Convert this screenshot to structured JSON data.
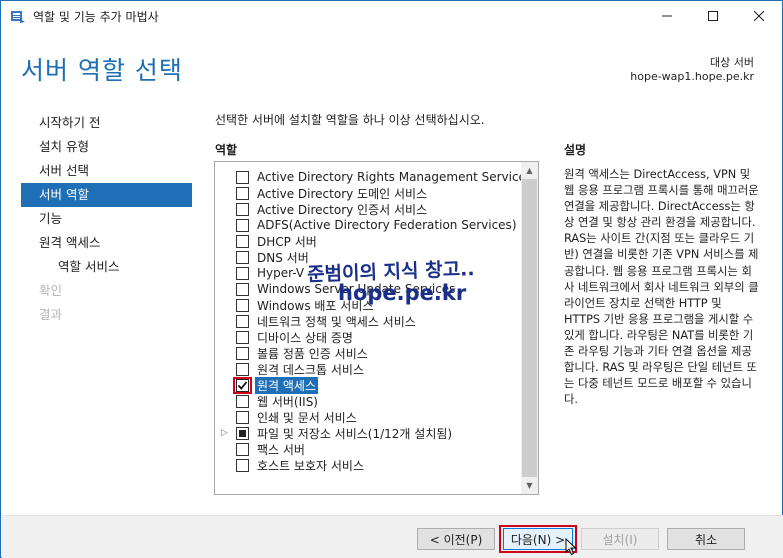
{
  "window": {
    "title": "역할 및 기능 추가 마법사"
  },
  "header": {
    "page_title": "서버 역할 선택",
    "dest_label": "대상 서버",
    "dest_server": "hope-wap1.hope.pe.kr"
  },
  "nav": {
    "items": [
      {
        "label": "시작하기 전",
        "state": "normal"
      },
      {
        "label": "설치 유형",
        "state": "normal"
      },
      {
        "label": "서버 선택",
        "state": "normal"
      },
      {
        "label": "서버 역할",
        "state": "selected"
      },
      {
        "label": "기능",
        "state": "normal"
      },
      {
        "label": "원격 액세스",
        "state": "normal"
      },
      {
        "label": "역할 서비스",
        "state": "sub"
      },
      {
        "label": "확인",
        "state": "disabled"
      },
      {
        "label": "결과",
        "state": "disabled"
      }
    ]
  },
  "main": {
    "instruction": "선택한 서버에 설치할 역할을 하나 이상 선택하십시오.",
    "roles_label": "역할",
    "roles": [
      {
        "label": "Active Directory Rights Management Services",
        "state": "unchecked"
      },
      {
        "label": "Active Directory 도메인 서비스",
        "state": "unchecked"
      },
      {
        "label": "Active Directory 인증서 서비스",
        "state": "unchecked"
      },
      {
        "label": "ADFS(Active Directory Federation Services)",
        "state": "unchecked"
      },
      {
        "label": "DHCP 서버",
        "state": "unchecked"
      },
      {
        "label": "DNS 서버",
        "state": "unchecked"
      },
      {
        "label": "Hyper-V",
        "state": "unchecked"
      },
      {
        "label": "Windows Server Update Services",
        "state": "unchecked"
      },
      {
        "label": "Windows 배포 서비스",
        "state": "unchecked"
      },
      {
        "label": "네트워크 정책 및 액세스 서비스",
        "state": "unchecked"
      },
      {
        "label": "디바이스 상태 증명",
        "state": "unchecked"
      },
      {
        "label": "볼륨 정품 인증 서비스",
        "state": "unchecked"
      },
      {
        "label": "원격 데스크톱 서비스",
        "state": "unchecked"
      },
      {
        "label": "원격 액세스",
        "state": "checked",
        "selected": true
      },
      {
        "label": "웹 서버(IIS)",
        "state": "unchecked"
      },
      {
        "label": "인쇄 및 문서 서비스",
        "state": "unchecked"
      },
      {
        "label": "파일 및 저장소 서비스(1/12개 설치됨)",
        "state": "partial",
        "expandable": true
      },
      {
        "label": "팩스 서버",
        "state": "unchecked"
      },
      {
        "label": "호스트 보호자 서비스",
        "state": "unchecked"
      }
    ]
  },
  "description": {
    "label": "설명",
    "text": "원격 액세스는 DirectAccess, VPN 및 웹 응용 프로그램 프록시를 통해 매끄러운 연결을 제공합니다. DirectAccess는 항상 연결 및 항상 관리 환경을 제공합니다. RAS는 사이트 간(지점 또는 클라우드 기반) 연결을 비롯한 기존 VPN 서비스를 제공합니다. 웹 응용 프로그램 프록시는 회사 네트워크에서 회사 네트워크 외부의 클라이언트 장치로 선택한 HTTP 및 HTTPS 기반 응용 프로그램을 게시할 수 있게 합니다. 라우팅은 NAT를 비롯한 기존 라우팅 기능과 기타 연결 옵션을 제공합니다. RAS 및 라우팅은 단일 테넌트 또는 다중 테넌트 모드로 배포할 수 있습니다."
  },
  "watermark": {
    "line1": "준범이의 지식 창고..",
    "line2": "hope.pe.kr"
  },
  "footer": {
    "prev_label": "< 이전(P)",
    "next_label": "다음(N) >",
    "install_label": "설치(I)",
    "cancel_label": "취소"
  },
  "colors": {
    "accent": "#1e6fb5",
    "highlight_frame": "#d0021b",
    "watermark": "#1a2f8a"
  }
}
